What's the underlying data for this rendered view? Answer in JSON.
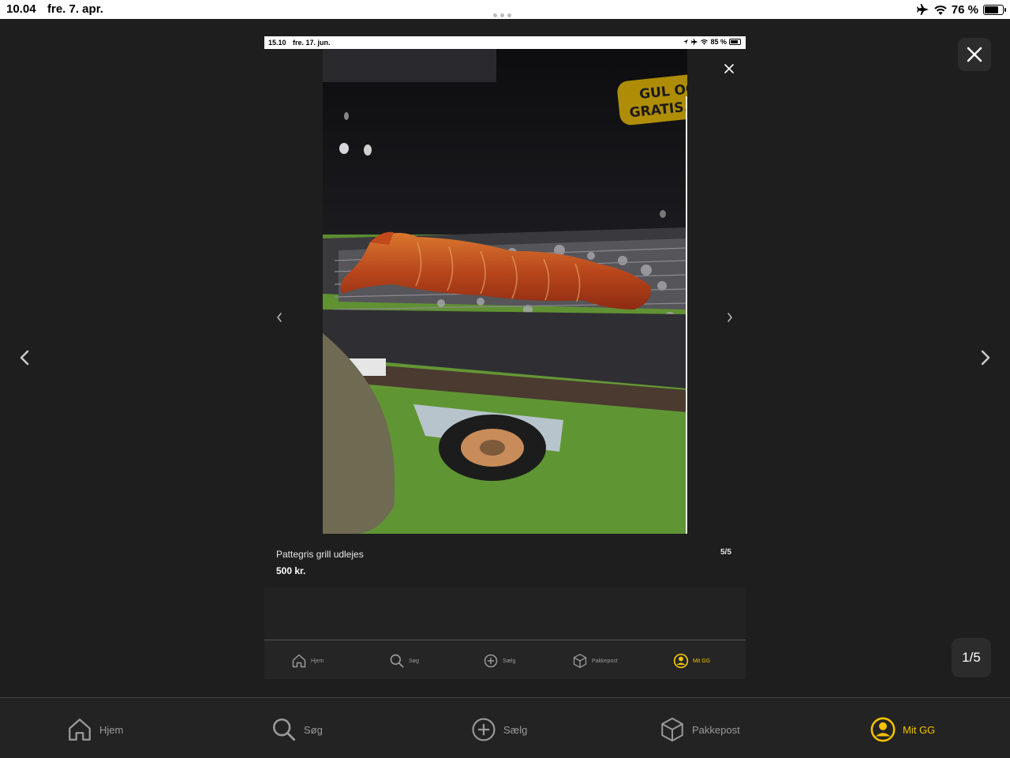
{
  "status_bar": {
    "time": "10.04",
    "date": "fre. 7. apr.",
    "battery": "76 %",
    "battery_level": 0.76,
    "icons": [
      "airplane-icon",
      "wifi-icon",
      "battery-icon"
    ]
  },
  "viewer": {
    "counter": "1/5",
    "close_icon": "close-icon",
    "prev_icon": "chevron-left-icon",
    "next_icon": "chevron-right-icon"
  },
  "inner_screenshot": {
    "status_bar": {
      "time": "15.10",
      "date": "fre. 17. jun.",
      "battery": "85 %",
      "battery_level": 0.85
    },
    "watermark": "GUL OG GRATIS.DK",
    "listing": {
      "title": "Pattegris grill udlejes",
      "price": "500 kr.",
      "counter": "5/5"
    },
    "tabs": [
      {
        "label": "Hjem",
        "icon": "home-icon"
      },
      {
        "label": "Søg",
        "icon": "search-icon"
      },
      {
        "label": "Sælg",
        "icon": "plus-circle-icon"
      },
      {
        "label": "Pakkepost",
        "icon": "package-icon"
      },
      {
        "label": "Mit GG",
        "icon": "user-circle-icon",
        "active": true
      }
    ]
  },
  "tabbar": {
    "items": [
      {
        "label": "Hjem",
        "icon": "home-icon"
      },
      {
        "label": "Søg",
        "icon": "search-icon"
      },
      {
        "label": "Sælg",
        "icon": "plus-circle-icon"
      },
      {
        "label": "Pakkepost",
        "icon": "package-icon"
      },
      {
        "label": "Mit GG",
        "icon": "user-circle-icon",
        "active": true
      }
    ]
  },
  "colors": {
    "background": "#1e1e1e",
    "accent": "#f2c200",
    "tab_inactive": "#9a9a9a"
  }
}
